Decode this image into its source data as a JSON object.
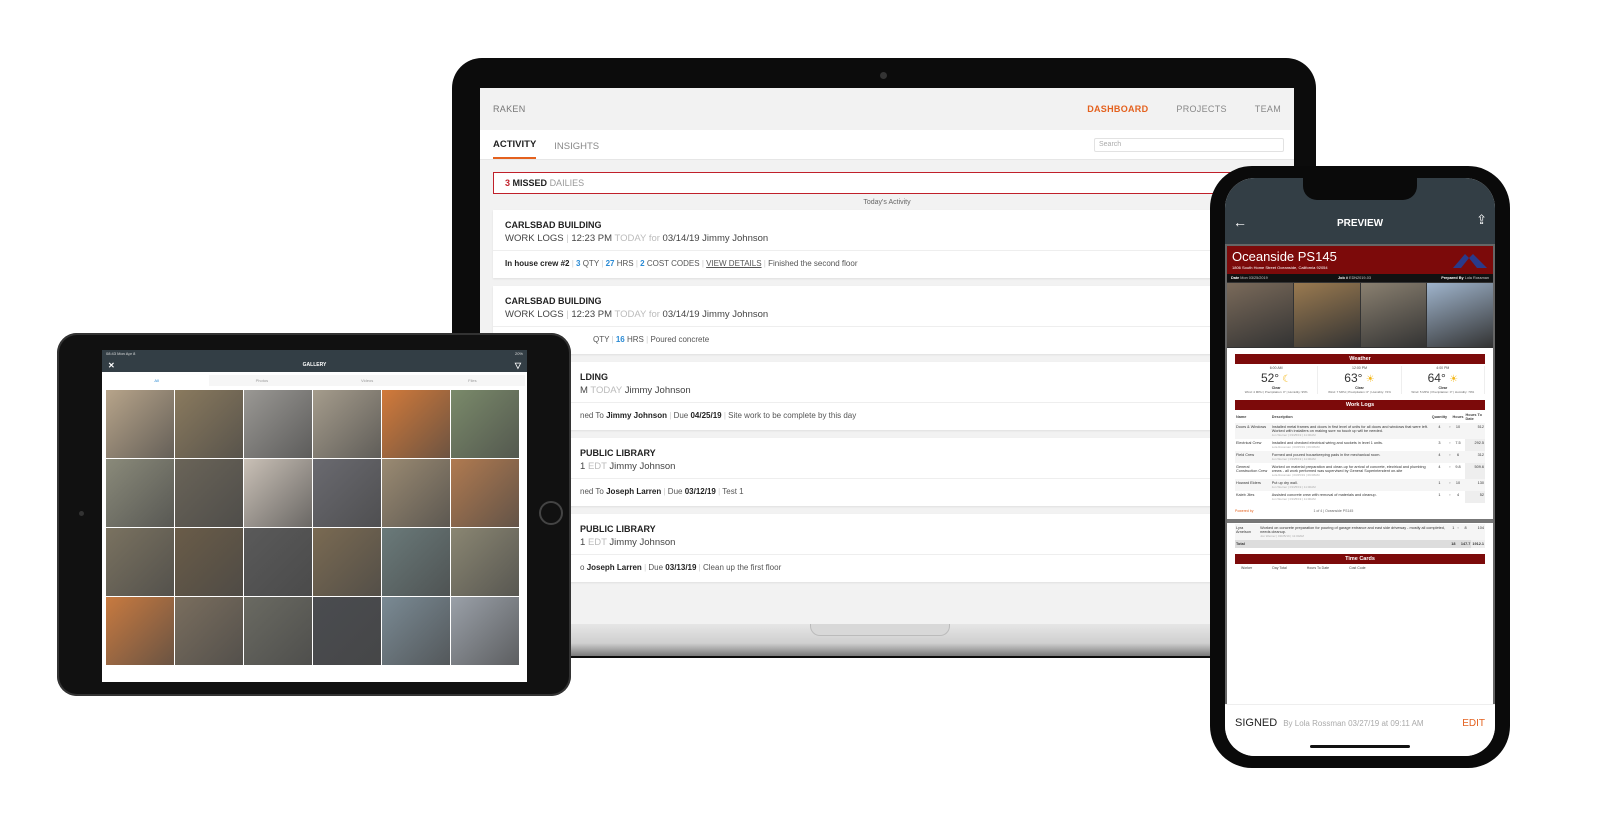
{
  "laptop": {
    "brand": "RAKEN",
    "nav": [
      "DASHBOARD",
      "PROJECTS",
      "TEAM"
    ],
    "nav_active": "DASHBOARD",
    "tabs": [
      "ACTIVITY",
      "INSIGHTS"
    ],
    "search_placeholder": "Search",
    "missed": {
      "count": "3",
      "bold": "MISSED",
      "label": "DAILIES"
    },
    "today_label": "Today's Activity",
    "cards": [
      {
        "project": "CARLSBAD BUILDING",
        "type": "WORK LOGS",
        "time": "12:23 PM",
        "today": "TODAY",
        "for": "for",
        "date": "03/14/19",
        "user": "Jimmy Johnson",
        "crew": "In house crew #2",
        "qty": "3",
        "qty_label": "QTY",
        "hrs": "27",
        "hrs_label": "HRS",
        "codes": "2",
        "codes_label": "COST CODES",
        "link": "VIEW DETAILS",
        "note": "Finished the second floor"
      },
      {
        "project": "CARLSBAD BUILDING",
        "type": "WORK LOGS",
        "time": "12:23 PM",
        "today": "TODAY",
        "for": "for",
        "date": "03/14/19",
        "user": "Jimmy Johnson",
        "qty_label": "QTY",
        "hrs": "16",
        "hrs_label": "HRS",
        "note": "Poured concrete"
      },
      {
        "project": "LDING",
        "time": "M",
        "today": "TODAY",
        "user": "Jimmy Johnson",
        "assigned": "ned To",
        "assignee": "Jimmy Johnson",
        "due_label": "Due",
        "due": "04/25/19",
        "note": "Site work to be complete by this day"
      },
      {
        "project": "PUBLIC LIBRARY",
        "time": "1",
        "tz": "EDT",
        "user": "Jimmy Johnson",
        "assigned": "ned To",
        "assignee": "Joseph Larren",
        "due_label": "Due",
        "due": "03/12/19",
        "note": "Test 1"
      },
      {
        "project": "PUBLIC LIBRARY",
        "time": "1",
        "tz": "EDT",
        "user": "Jimmy Johnson",
        "assigned": "o",
        "assignee": "Joseph Larren",
        "due_label": "Due",
        "due": "03/13/19",
        "note": "Clean up the first floor"
      }
    ]
  },
  "tablet": {
    "status_time": "08:43  Mon Apr 8",
    "status_right": "20%",
    "title": "GALLERY",
    "close_icon": "close-icon",
    "filter_icon": "filter-icon",
    "tabs": [
      "All",
      "Photos",
      "Videos",
      "Files"
    ],
    "tab_active": "All",
    "photos": [
      "#b7a48a",
      "#8a7a5e",
      "#9a9894",
      "#a59c8c",
      "#d27a3a",
      "#7a8a6a",
      "#8a8a7a",
      "#6a6458",
      "#c9c0b6",
      "#6a6a70",
      "#9a8a72",
      "#b07a50",
      "#7a7260",
      "#6a5c48",
      "#5a5a5a",
      "#7a6a52",
      "#6a7a7a",
      "#8a8672",
      "#c87a40",
      "#7a6e5e",
      "#6a6a62",
      "#4a4c50",
      "#7a8a94",
      "#9aa0a8"
    ]
  },
  "phone": {
    "header_title": "PREVIEW",
    "project": "Oceanside PS145",
    "address": "1806 South Home Street Oceanside, California 92054",
    "date_label": "Date",
    "date": "Mon 03/25/2019",
    "job_label": "Job #",
    "job": "EDN2019-03",
    "prepared_label": "Prepared By",
    "prepared": "Lola Rossman",
    "weather_title": "Weather",
    "weather": [
      {
        "time": "6:00 AM",
        "temp": "52°",
        "icon": "moon",
        "cond": "Clear",
        "detail": "Wind: 4 MPH | Precipitation: 0\" | Humidity: 95%"
      },
      {
        "time": "12:00 PM",
        "temp": "63°",
        "icon": "sun",
        "cond": "Clear",
        "detail": "Wind: 7 MPH | Precipitation: 0\" | Humidity: 72%"
      },
      {
        "time": "4:00 PM",
        "temp": "64°",
        "icon": "sun",
        "cond": "Clear",
        "detail": "Wind: 5 MPH | Precipitation: 0\" | Humidity: 70%"
      }
    ],
    "worklogs_title": "Work Logs",
    "worklog_headers": [
      "Name",
      "Description",
      "Quantity",
      "Hours",
      "Hours To Date"
    ],
    "worklogs": [
      {
        "name": "Doors & Windows",
        "desc": "Installed metal frames and doors in first level of units for all doors and windows that were left. Worked with installers on making sure no touch up will be needed.",
        "by": "Jon Werner | 03/25/19 | 11:00AM",
        "qty": "4",
        "hours": "10",
        "to_date": "512"
      },
      {
        "name": "Electrical Crew",
        "desc": "Installed and checked electrical wiring and sockets in level 1 units.",
        "by": "Lola Rossman | 03/25/19 | 09:08AM",
        "qty": "3",
        "hours": "7.5",
        "to_date": "292.5"
      },
      {
        "name": "Field Crew",
        "desc": "Formed and poured housekeeping pads in the mechanical room.",
        "by": "Jon Werner | 03/25/19 | 11:00AM",
        "qty": "4",
        "hours": "6",
        "to_date": "312"
      },
      {
        "name": "General Construction Crew",
        "desc": "Worked on material preparation and clean-up for arrival of concrete, electrical and plumbing crews - all work performed was supervised by General Superintendent on-site",
        "by": "Lola Rossman | 03/25/19 | 09:08AM",
        "qty": "4",
        "hours": "9.8",
        "to_date": "509.6"
      },
      {
        "name": "Howard Elders",
        "desc": "Put up dry wall.",
        "by": "Jon Werner | 03/25/19 | 11:00AM",
        "qty": "1",
        "hours": "10",
        "to_date": "130"
      },
      {
        "name": "Kaleb Jiles",
        "desc": "Assisted concrete crew with removal of materials and cleanup.",
        "by": "Jon Werner | 03/25/19 | 11:00AM",
        "qty": "1",
        "hours": "4",
        "to_date": "52"
      }
    ],
    "powered_by": "Powered by",
    "page_footer": "1 of 4  |  Oceanside PS145",
    "worklogs_2": [
      {
        "name": "Lyra Arnelson",
        "desc": "Worked on concrete preparation for pouring of garage entrance and east side driveway - mostly all completed, needs cleanup.",
        "by": "Jon Werner | 03/25/19 | 11:00AM",
        "qty": "1",
        "hours": "8",
        "to_date": "104"
      }
    ],
    "total_label": "Total",
    "total_qty": "18",
    "total_hours": "147.7",
    "total_to_date": "1912.1",
    "timecards_title": "Time Cards",
    "timecard_headers": [
      "Worker",
      "Day Total",
      "Hours To Date",
      "Cost Code"
    ],
    "signed": "SIGNED",
    "signed_by": "By Lola Rossman 03/27/19 at 09:11 AM",
    "edit": "EDIT",
    "photo_colors": [
      "#7a6a5a",
      "#9a7a50",
      "#8a8070",
      "#9fb4cc"
    ]
  }
}
